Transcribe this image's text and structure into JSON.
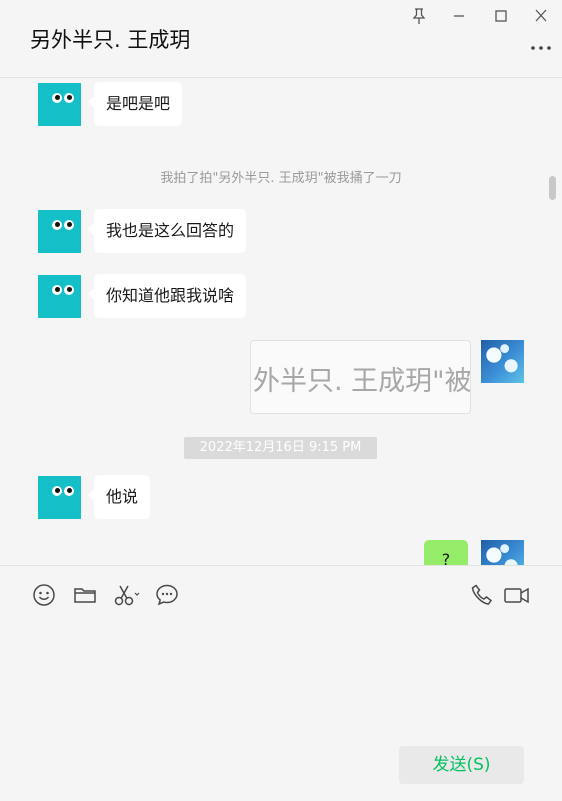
{
  "window": {
    "title": "另外半只. 王成玥",
    "icons": [
      "pin-icon",
      "minimize-icon",
      "maximize-icon",
      "close-icon",
      "more-icon"
    ]
  },
  "messages": [
    {
      "side": "left",
      "type": "text",
      "text": "是吧是吧"
    },
    {
      "type": "system",
      "text": "我拍了拍\"另外半只. 王成玥\"被我捅了一刀"
    },
    {
      "side": "left",
      "type": "text",
      "text": "我也是这么回答的"
    },
    {
      "side": "left",
      "type": "text",
      "text": "你知道他跟我说啥"
    },
    {
      "side": "right",
      "type": "image",
      "text": "外半只. 王成玥\"被"
    },
    {
      "type": "timestamp",
      "text": "2022年12月16日 9:15 PM"
    },
    {
      "side": "left",
      "type": "text",
      "text": "他说"
    },
    {
      "side": "right",
      "type": "text",
      "text": "?"
    }
  ],
  "toolbar": {
    "icons": [
      "emoji-icon",
      "folder-icon",
      "scissors-icon",
      "chat-bubble-icon",
      "phone-icon",
      "video-icon"
    ]
  },
  "input": {
    "send_label": "发送(S)"
  },
  "colors": {
    "accent": "#07c160",
    "bubble_right": "#95ec69",
    "bubble_left": "#ffffff",
    "background": "#f5f5f5",
    "avatar": "#15bfc7"
  }
}
